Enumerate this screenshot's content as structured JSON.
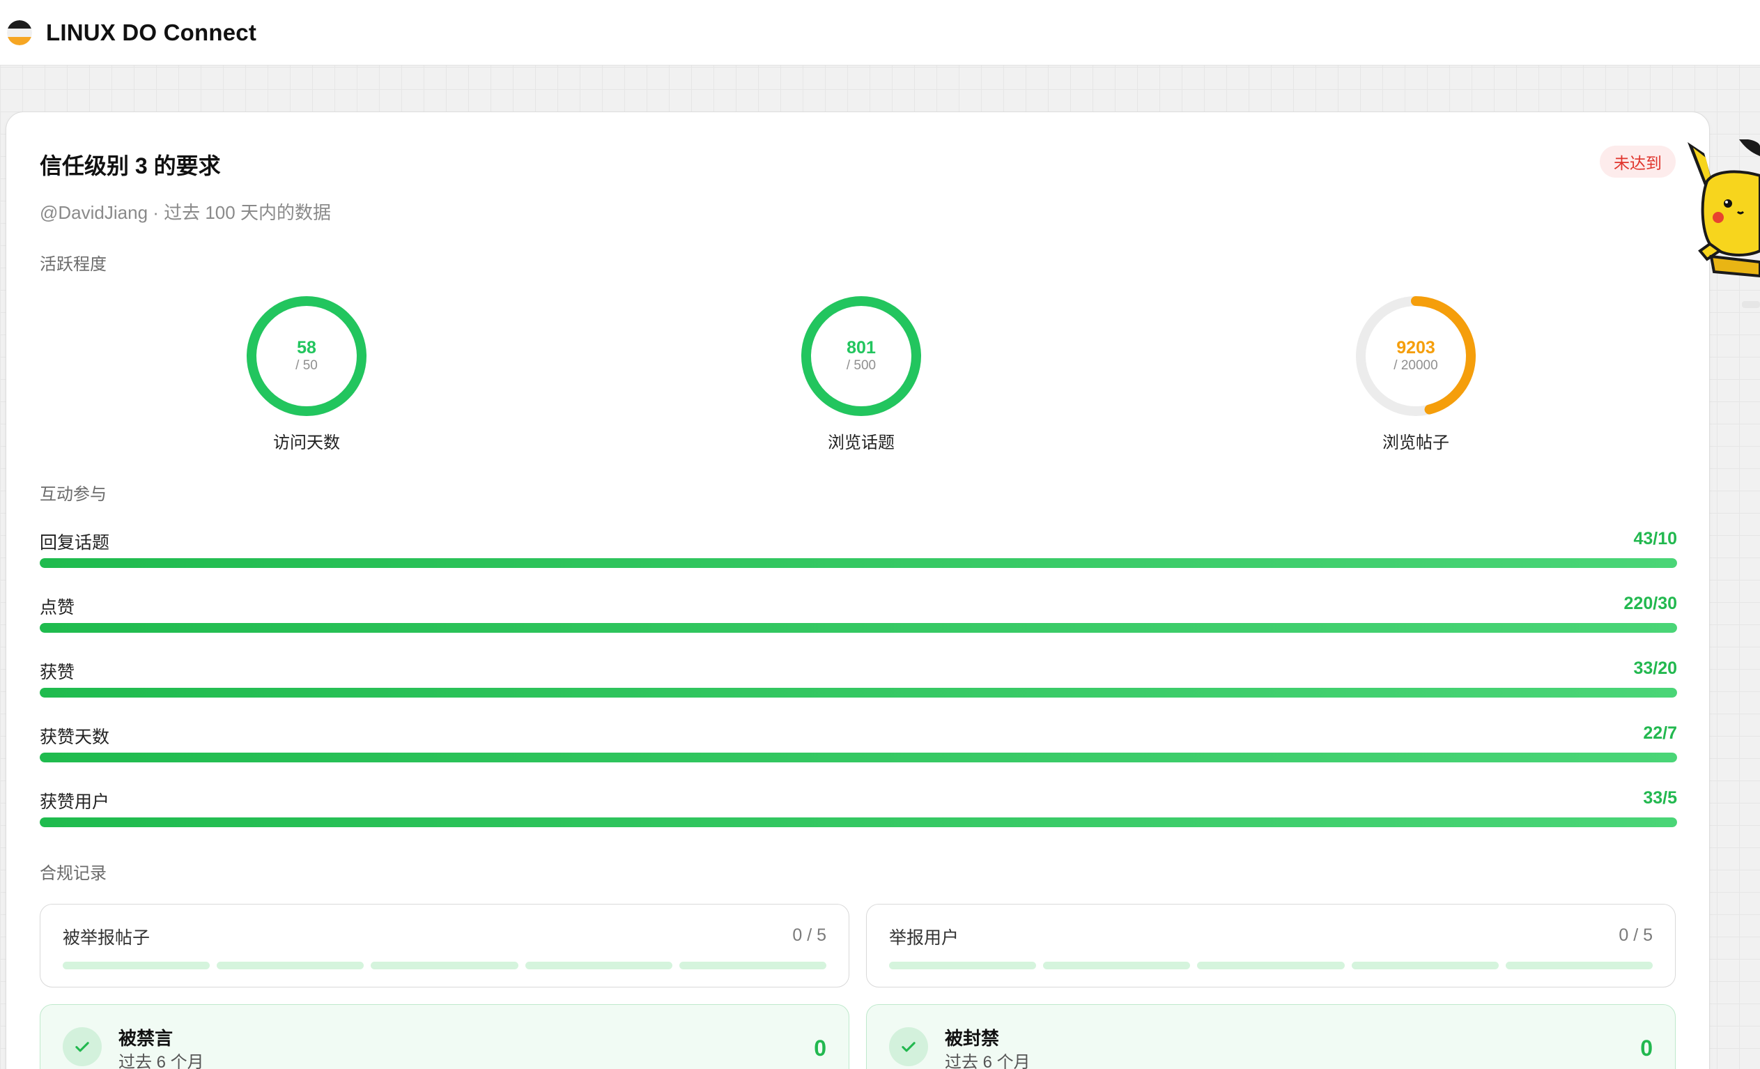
{
  "app": {
    "title": "LINUX DO Connect"
  },
  "card": {
    "title": "信任级别 3 的要求",
    "status": "未达到",
    "subtitle": "@DavidJiang · 过去 100 天内的数据"
  },
  "activity": {
    "label": "活跃程度",
    "rings": [
      {
        "label": "访问天数",
        "value": "58",
        "target": "/ 50",
        "progress": 1.0,
        "color": "#22c55e"
      },
      {
        "label": "浏览话题",
        "value": "801",
        "target": "/ 500",
        "progress": 1.0,
        "color": "#22c55e"
      },
      {
        "label": "浏览帖子",
        "value": "9203",
        "target": "/ 20000",
        "progress": 0.46,
        "color": "#f59e0b"
      }
    ]
  },
  "interaction": {
    "label": "互动参与",
    "bars": [
      {
        "label": "回复话题",
        "value": "43/10",
        "progress": 1.0
      },
      {
        "label": "点赞",
        "value": "220/30",
        "progress": 1.0
      },
      {
        "label": "获赞",
        "value": "33/20",
        "progress": 1.0
      },
      {
        "label": "获赞天数",
        "value": "22/7",
        "progress": 1.0
      },
      {
        "label": "获赞用户",
        "value": "33/5",
        "progress": 1.0
      }
    ]
  },
  "compliance": {
    "label": "合规记录",
    "reports": [
      {
        "label": "被举报帖子",
        "value": "0 / 5",
        "progress": 0
      },
      {
        "label": "举报用户",
        "value": "0 / 5",
        "progress": 0
      }
    ],
    "bans": [
      {
        "title": "被禁言",
        "sub": "过去 6 个月",
        "value": "0"
      },
      {
        "title": "被封禁",
        "sub": "过去 6 个月",
        "value": "0"
      }
    ]
  },
  "colors": {
    "accent": "#22c55e",
    "warning": "#f59e0b",
    "danger": "#e0342c"
  },
  "icons": {
    "logo": "linux-do-logo-icon",
    "check": "check-icon",
    "mascot": "pikachu-mascot"
  }
}
